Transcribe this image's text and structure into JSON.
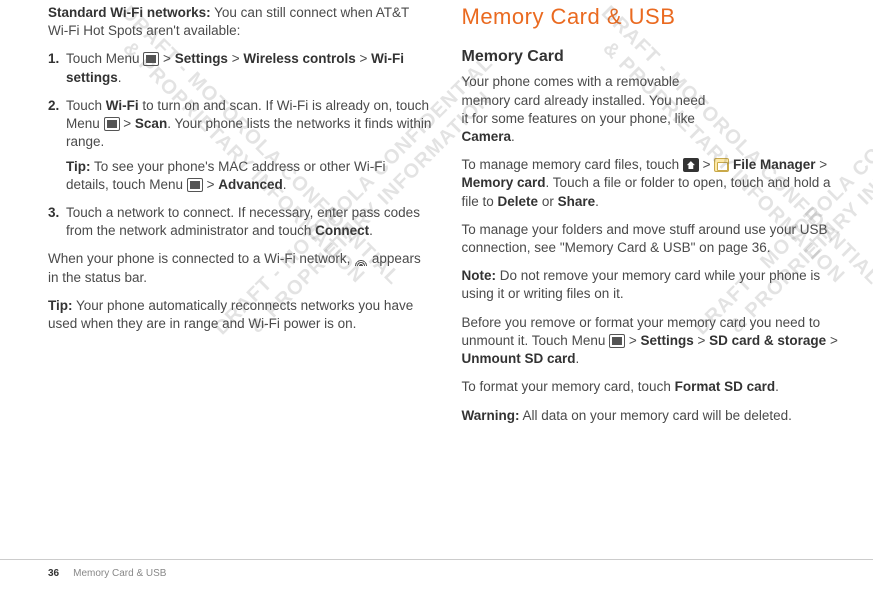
{
  "left": {
    "intro_bold": "Standard Wi-Fi networks:",
    "intro_rest": " You can still connect when AT&T Wi-Fi Hot Spots aren't available:",
    "steps": {
      "s1": {
        "num": "1.",
        "t1": "Touch Menu ",
        "t2": " > ",
        "b_settings": "Settings",
        "t3": " > ",
        "b_wireless": "Wireless controls",
        "t4": " > ",
        "b_wifi_settings": "Wi-Fi settings",
        "t5": "."
      },
      "s2": {
        "num": "2.",
        "t1": "Touch ",
        "b_wifi": "Wi-Fi",
        "t2": " to turn on and scan. If Wi-Fi is already on, touch Menu ",
        "t3": " > ",
        "b_scan": "Scan",
        "t4": ". Your phone lists the networks it finds within range.",
        "tip_b": "Tip:",
        "tip_t1": " To see your phone's MAC address or other Wi-Fi details, touch Menu ",
        "tip_t2": " > ",
        "tip_b_adv": "Advanced",
        "tip_t3": "."
      },
      "s3": {
        "num": "3.",
        "t1": "Touch a network to connect. If necessary, enter pass codes from the network administrator and touch ",
        "b_connect": "Connect",
        "t2": "."
      }
    },
    "connected_t1": "When your phone is connected to a Wi-Fi network, ",
    "connected_t2": " appears in the status bar.",
    "tip2_b": "Tip:",
    "tip2_t": " Your phone automatically reconnects networks you have used when they are in range and Wi-Fi power is on."
  },
  "right": {
    "title": "Memory Card & USB",
    "subheading": "Memory Card",
    "p1": "Your phone comes with a removable memory card already installed. You need it for some features on your phone, like ",
    "p1_b": "Camera",
    "p1_end": ".",
    "p2_t1": "To manage memory card files, touch ",
    "p2_t2": " > ",
    "p2_b_fm": "File Manager",
    "p2_t3": " > ",
    "p2_b_mc": "Memory card",
    "p2_t4": ". Touch a file or folder to open, touch and hold a file to ",
    "p2_b_del": "Delete",
    "p2_t5": " or ",
    "p2_b_share": "Share",
    "p2_t6": ".",
    "p3": "To manage your folders and move stuff around use your USB connection, see \"Memory Card & USB\" on page 36.",
    "note_b": "Note:",
    "note_t": " Do not remove your memory card while your phone is using it or writing files on it.",
    "p5_t1": "Before you remove or format your memory card you need to unmount it. Touch Menu ",
    "p5_t2": " > ",
    "p5_b_set": "Settings",
    "p5_t3": " > ",
    "p5_b_sd": "SD card & storage",
    "p5_t4": " > ",
    "p5_b_unmount": "Unmount SD card",
    "p5_t5": ".",
    "p6_t1": "To format your memory card, touch ",
    "p6_b_format": "Format SD card",
    "p6_t2": ".",
    "warn_b": "Warning:",
    "warn_t": " All data on your memory card will be deleted."
  },
  "footer": {
    "page": "36",
    "label": "Memory Card & USB"
  },
  "watermarks": {
    "a": "DRAFT - MOTOROLA CONFIDENTIAL\n& PROPRIETARY INFORMATION",
    "b": "DRAFT - MOTOROLA CONFIDENTIAL\n& PROPRIETARY INFORMATION"
  }
}
